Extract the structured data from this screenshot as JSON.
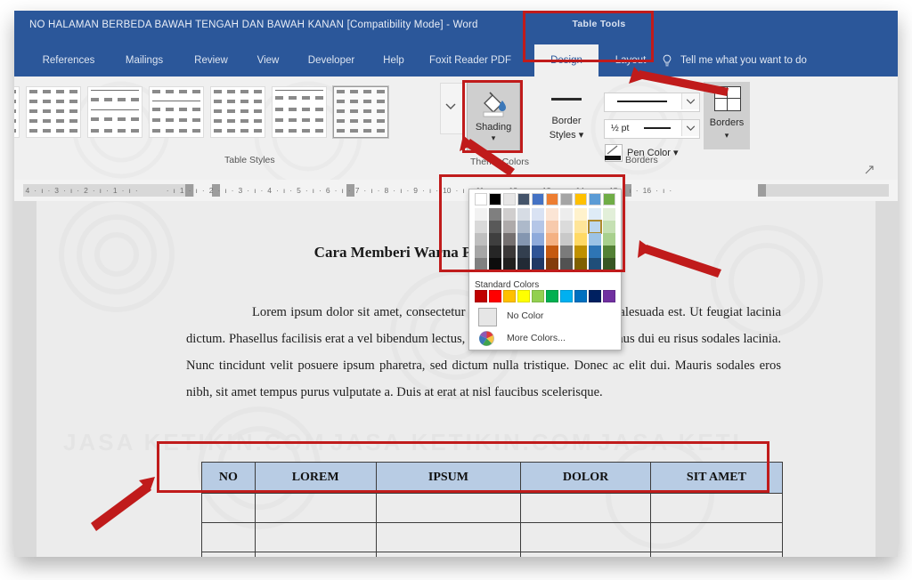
{
  "window": {
    "title": "NO HALAMAN BERBEDA BAWAH TENGAH DAN BAWAH KANAN [Compatibility Mode]  -  Word",
    "titlebar_color": "#2b579a"
  },
  "contextual_tab": {
    "group_label": "Table Tools",
    "tabs": [
      {
        "label": "Design",
        "active": true
      },
      {
        "label": "Layout",
        "active": false
      }
    ]
  },
  "ribbon_tabs": [
    {
      "label": "References"
    },
    {
      "label": "Mailings"
    },
    {
      "label": "Review"
    },
    {
      "label": "View"
    },
    {
      "label": "Developer"
    },
    {
      "label": "Help"
    },
    {
      "label": "Foxit Reader PDF"
    }
  ],
  "tell_me": {
    "label": "Tell me what you want to do",
    "icon": "lightbulb-icon"
  },
  "ribbon": {
    "groups": [
      {
        "label": "Table Styles"
      },
      {
        "label": "Borders"
      }
    ],
    "shading": {
      "label": "Shading",
      "caret": "▾",
      "icon": "paint-bucket-icon",
      "active": true
    },
    "border_styles": {
      "line1": "Border",
      "line2": "Styles ▾"
    },
    "line_style": {
      "value": ""
    },
    "line_weight": {
      "value": "½ pt"
    },
    "pen_color": {
      "label": "Pen Color ▾",
      "swatch": "#ffffff"
    },
    "borders": {
      "label": "Borders",
      "caret": "▾"
    }
  },
  "ruler": {
    "marks": [
      "4",
      "3",
      "2",
      "1",
      "1",
      "2",
      "3",
      "4",
      "5",
      "6",
      "7",
      "8",
      "9",
      "10",
      "11",
      "12",
      "13",
      "14",
      "15",
      "16"
    ]
  },
  "palette": {
    "theme_title": "Theme Colors",
    "standard_title": "Standard Colors",
    "no_color_label": "No Color",
    "more_colors_label": "More Colors...",
    "highlight_border": "#b08b2e",
    "theme_columns": [
      {
        "base": "#ffffff",
        "shades": [
          "#f2f2f2",
          "#d9d9d9",
          "#bfbfbf",
          "#a6a6a6",
          "#808080"
        ]
      },
      {
        "base": "#000000",
        "shades": [
          "#7f7f7f",
          "#595959",
          "#3f3f3f",
          "#262626",
          "#0d0d0d"
        ]
      },
      {
        "base": "#e7e6e6",
        "shades": [
          "#d0cece",
          "#aeaaaa",
          "#757070",
          "#3b3838",
          "#201f1e"
        ]
      },
      {
        "base": "#44546a",
        "shades": [
          "#d6dce4",
          "#adb9ca",
          "#8496b0",
          "#333f4f",
          "#222a35"
        ]
      },
      {
        "base": "#4472c4",
        "shades": [
          "#d9e2f3",
          "#b4c6e7",
          "#8eaadb",
          "#2f5496",
          "#1f3864"
        ]
      },
      {
        "base": "#ed7d31",
        "shades": [
          "#fbe5d5",
          "#f7caac",
          "#f4b183",
          "#c55a11",
          "#833c0b"
        ]
      },
      {
        "base": "#a5a5a5",
        "shades": [
          "#ededed",
          "#dbdbdb",
          "#c9c9c9",
          "#7b7b7b",
          "#525252"
        ]
      },
      {
        "base": "#ffc000",
        "shades": [
          "#fff2cc",
          "#ffe599",
          "#ffd965",
          "#bf9000",
          "#7f6000"
        ]
      },
      {
        "base": "#5b9bd5",
        "shades": [
          "#deebf6",
          "#bdd7ee",
          "#9cc3e5",
          "#2e75b5",
          "#1f4e79"
        ]
      },
      {
        "base": "#70ad47",
        "shades": [
          "#e2efd9",
          "#c5e0b3",
          "#a8d08d",
          "#538135",
          "#375623"
        ]
      }
    ],
    "highlight_cell": {
      "column": 8,
      "row": 1
    },
    "standard_colors": [
      "#c00000",
      "#ff0000",
      "#ffc000",
      "#ffff00",
      "#92d050",
      "#00b050",
      "#00b0f0",
      "#0070c0",
      "#002060",
      "#7030a0"
    ]
  },
  "document": {
    "heading": "Cara Memberi Warna Pada Tabel Word",
    "paragraph": "Lorem ipsum dolor sit amet, consectetur adipiscing elit. Donec sed malesuada est. Ut feugiat lacinia dictum. Phasellus facilisis erat a vel bibendum lectus, eu ultrices nisl. Morbi maximus dui eu risus sodales lacinia. Nunc tincidunt velit posuere ipsum pharetra, sed dictum nulla tristique. Donec ac elit dui. Mauris sodales eros nibh, sit amet tempus purus vulputate a. Duis at erat at nisl faucibus scelerisque.",
    "table": {
      "header_fill": "#b8cce4",
      "headers": [
        "NO",
        "LOREM",
        "IPSUM",
        "DOLOR",
        "SIT AMET"
      ],
      "empty_rows": 3
    }
  },
  "annotations": {
    "color": "#c01b1b",
    "highlight_boxes": [
      "table-tools-tab-group",
      "shading-button",
      "color-palette",
      "document-table-header"
    ],
    "arrows": 4
  }
}
